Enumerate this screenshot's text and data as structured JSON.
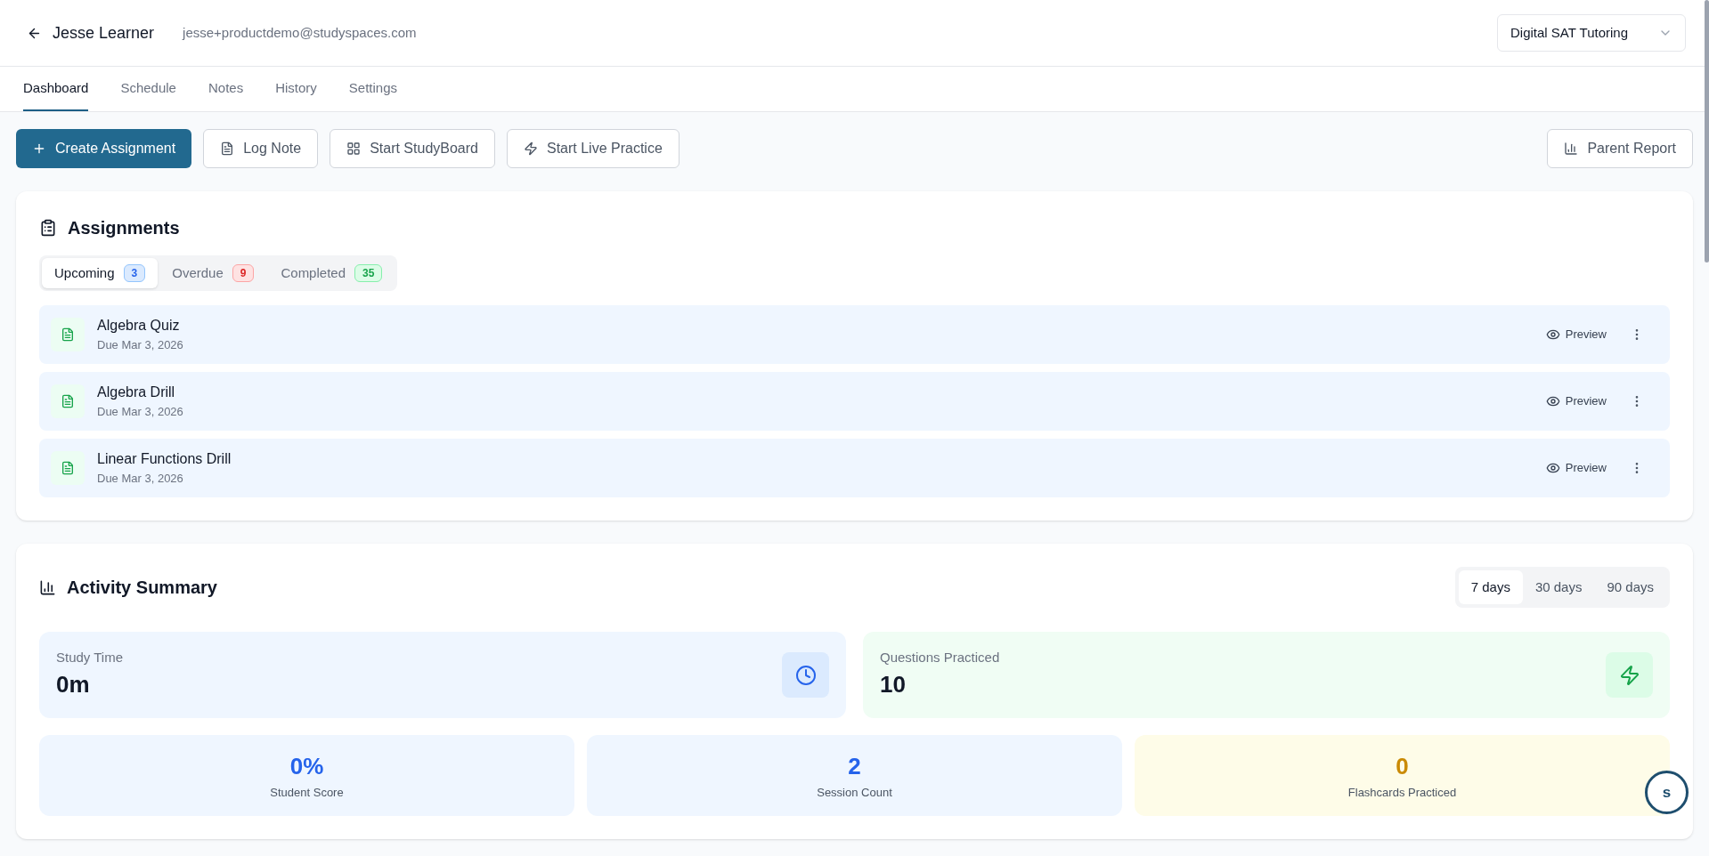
{
  "header": {
    "name": "Jesse Learner",
    "email": "jesse+productdemo@studyspaces.com",
    "program_select": {
      "value": "Digital SAT Tutoring"
    }
  },
  "tabs": [
    {
      "label": "Dashboard",
      "selected": true
    },
    {
      "label": "Schedule",
      "selected": false
    },
    {
      "label": "Notes",
      "selected": false
    },
    {
      "label": "History",
      "selected": false
    },
    {
      "label": "Settings",
      "selected": false
    }
  ],
  "actions": [
    {
      "label": "Create Assignment",
      "kind": "primary"
    },
    {
      "label": "Log Note",
      "kind": "outline"
    },
    {
      "label": "Start StudyBoard",
      "kind": "outline"
    },
    {
      "label": "Start Live Practice",
      "kind": "outline"
    }
  ],
  "parent_report": {
    "label": "Parent Report"
  },
  "assignments": {
    "title": "Assignments",
    "filters": [
      {
        "label": "Upcoming",
        "count": "3",
        "color": "#2563eb",
        "selected": true
      },
      {
        "label": "Overdue",
        "count": "9",
        "color": "#dc2626",
        "selected": false
      },
      {
        "label": "Completed",
        "count": "35",
        "color": "#16a34a",
        "selected": false
      }
    ],
    "items": [
      {
        "title": "Algebra Quiz",
        "due": "Due Mar 3, 2026",
        "action": "Preview"
      },
      {
        "title": "Algebra Drill",
        "due": "Due Mar 3, 2026",
        "action": "Preview"
      },
      {
        "title": "Linear Functions Drill",
        "due": "Due Mar 3, 2026",
        "action": "Preview"
      }
    ]
  },
  "activity": {
    "title": "Activity Summary",
    "ranges": [
      {
        "label": "7 days",
        "selected": true
      },
      {
        "label": "30 days",
        "selected": false
      },
      {
        "label": "90 days",
        "selected": false
      }
    ],
    "wide_stats": [
      {
        "label": "Study Time",
        "value": "0m",
        "color": "#2563eb"
      },
      {
        "label": "Questions Practiced",
        "value": "10",
        "color": "#16a34a"
      }
    ],
    "small_stats": [
      {
        "value": "0%",
        "label": "Student Score",
        "color": "#2563eb"
      },
      {
        "value": "2",
        "label": "Session Count",
        "color": "#2563eb"
      },
      {
        "value": "0",
        "label": "Flashcards Practiced",
        "color": "#ca8a04"
      }
    ]
  },
  "help_button": {
    "label": "s"
  }
}
